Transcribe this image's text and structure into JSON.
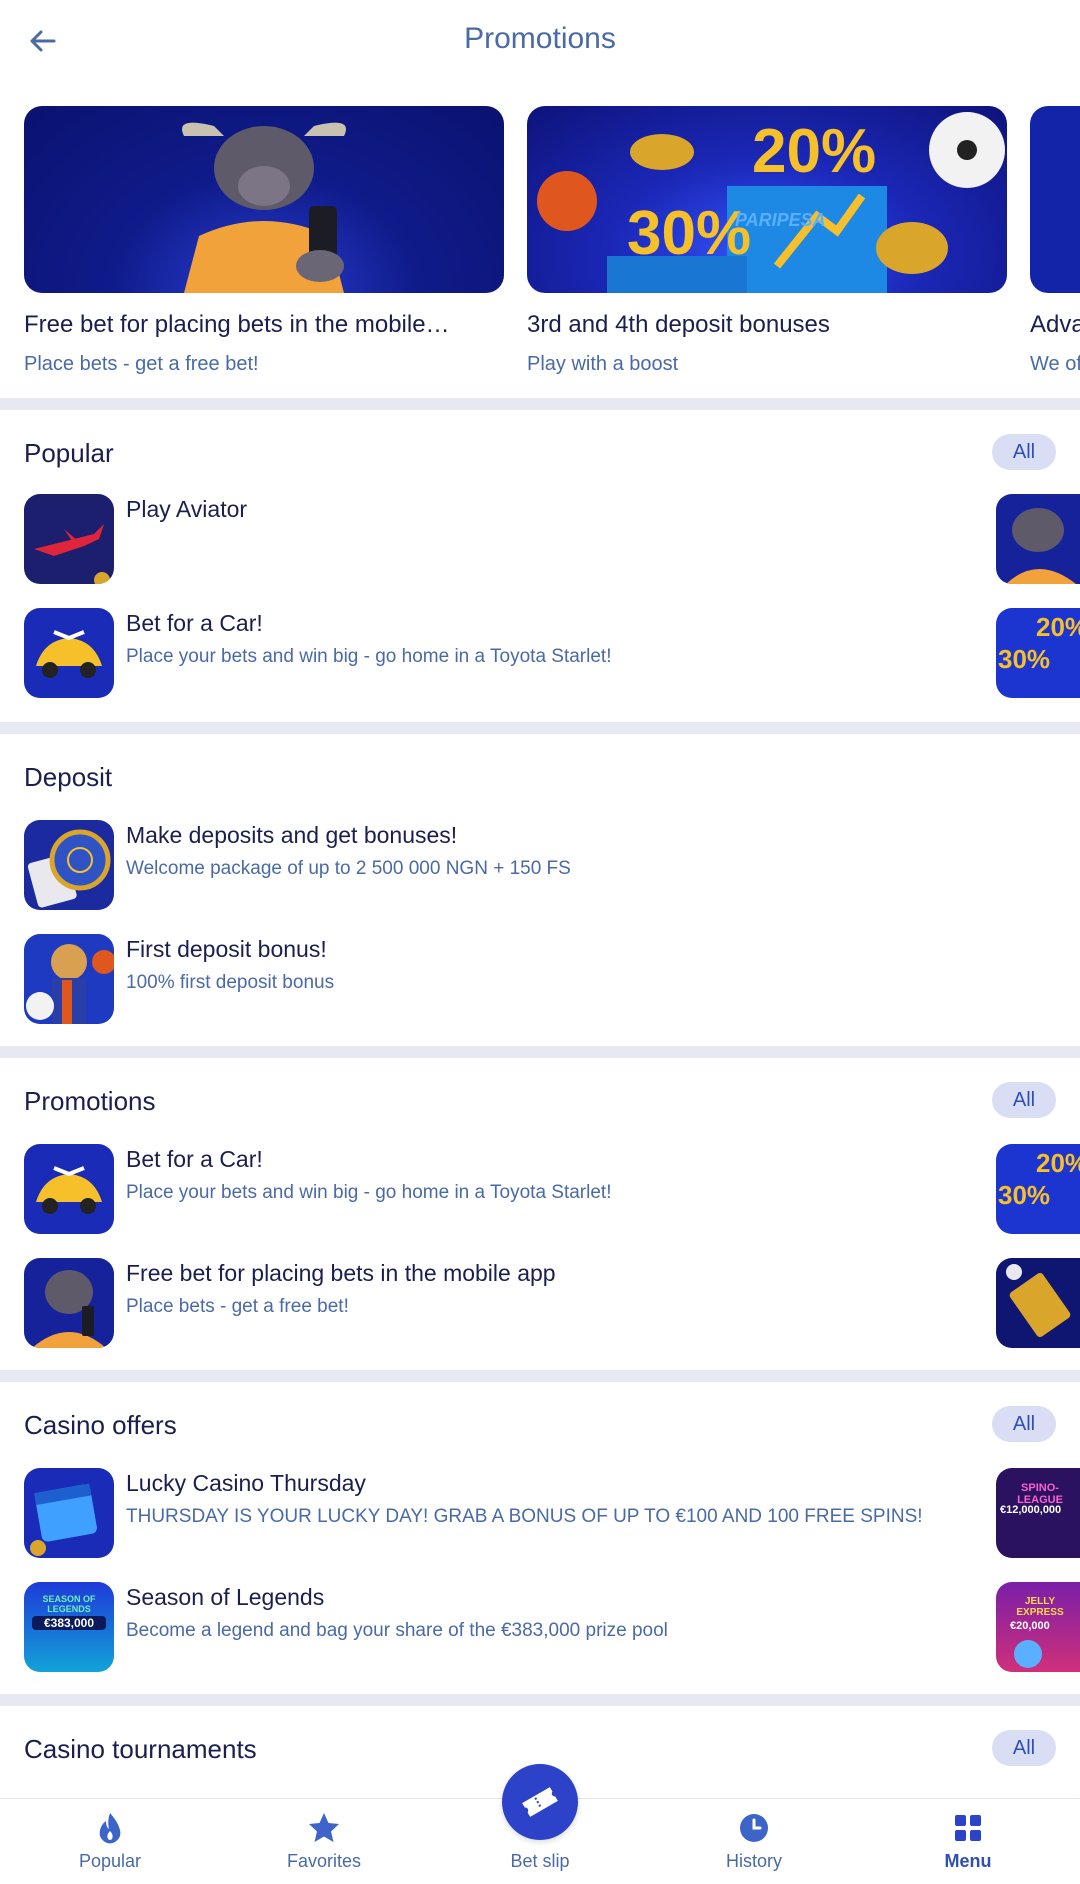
{
  "header": {
    "title": "Promotions"
  },
  "banners": [
    {
      "title": "Free bet for placing bets in the mobile…",
      "subtitle": "Place bets - get a free bet!"
    },
    {
      "title": "3rd and 4th deposit bonuses",
      "subtitle": "Play with a boost",
      "overlay": [
        "20%",
        "30%",
        "PARIPESA"
      ]
    },
    {
      "title": "Adva",
      "subtitle": "We of"
    }
  ],
  "sections": {
    "popular": {
      "title": "Popular",
      "all_label": "All",
      "items": [
        {
          "title": "Play Aviator",
          "subtitle": ""
        },
        {
          "title": "Bet for a Car!",
          "subtitle": "Place your bets and win big - go home in a Toyota Starlet!"
        }
      ]
    },
    "deposit": {
      "title": "Deposit",
      "items": [
        {
          "title": "Make deposits and get bonuses!",
          "subtitle": "Welcome package of up to 2 500 000 NGN + 150 FS"
        },
        {
          "title": "First deposit bonus!",
          "subtitle": "100% first deposit bonus"
        }
      ]
    },
    "promotions": {
      "title": "Promotions",
      "all_label": "All",
      "items": [
        {
          "title": "Bet for a Car!",
          "subtitle": "Place your bets and win big - go home in a Toyota Starlet!"
        },
        {
          "title": "Free bet for placing bets in the mobile app",
          "subtitle": "Place bets - get a free bet!"
        }
      ]
    },
    "casino_offers": {
      "title": "Casino offers",
      "all_label": "All",
      "items": [
        {
          "title": "Lucky Casino Thursday",
          "subtitle": "THURSDAY IS YOUR LUCKY DAY! GRAB A BONUS OF UP TO €100 AND 100 FREE SPINS!"
        },
        {
          "title": "Season of Legends",
          "subtitle": "Become a legend and bag your share of the €383,000 prize pool"
        }
      ],
      "side_labels": [
        "SPINO-LEAGUE",
        "€12,000,000",
        "JELLY EXPRESS",
        "€20,000"
      ],
      "thumb_labels": [
        "SEASON OF LEGENDS",
        "€383,000"
      ]
    },
    "casino_tournaments": {
      "title": "Casino tournaments",
      "all_label": "All"
    }
  },
  "bottom_nav": {
    "popular": "Popular",
    "favorites": "Favorites",
    "bet_slip": "Bet slip",
    "history": "History",
    "menu": "Menu"
  },
  "colors": {
    "accent": "#2c43c9",
    "navy": "#1a1f4d",
    "muted": "#4a6aa6",
    "divider": "#e6e9f0",
    "pill": "#d9def5"
  }
}
